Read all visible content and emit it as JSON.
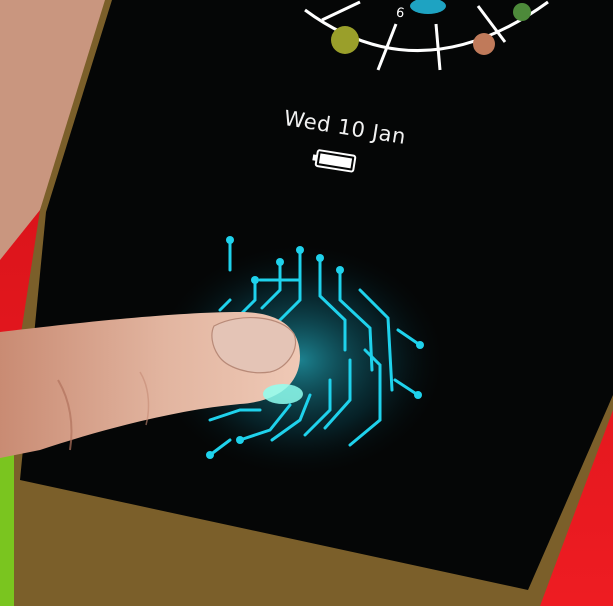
{
  "lockscreen": {
    "date": "Wed 10 Jan",
    "clock_numeral": "6",
    "icons": [
      "battery-icon",
      "fingerprint-icon"
    ]
  },
  "colors": {
    "background": "#e1141b",
    "phone_body": "#070808",
    "frame": "#8a6a2e",
    "fingerprint_glow": "#19c8e6",
    "skin": "#d9a58e",
    "green_accent": "#7ac51f"
  }
}
